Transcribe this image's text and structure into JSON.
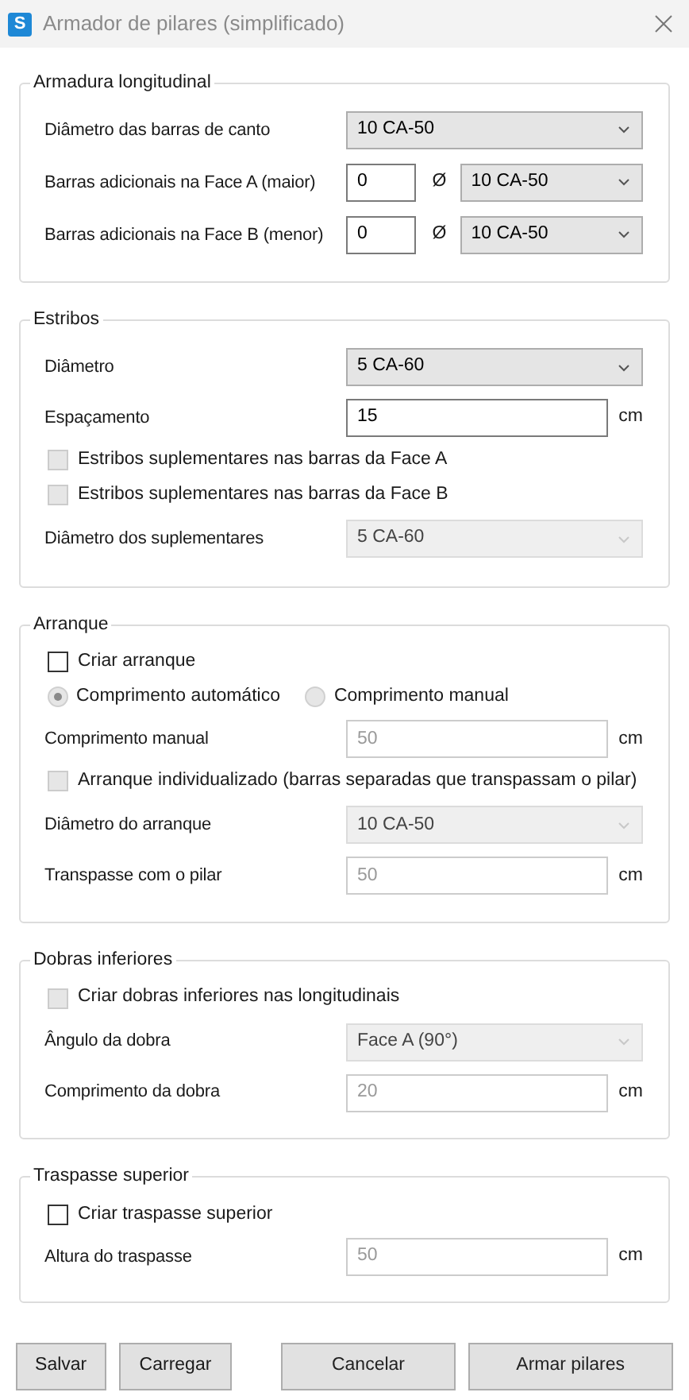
{
  "window": {
    "title": "Armador de pilares (simplificado)",
    "app_icon": "S"
  },
  "sections": [
    {
      "title": "Armadura longitudinal",
      "rows": [
        {
          "kind": "select",
          "label": "Diâmetro das barras de canto",
          "value": "10 CA-50",
          "disabled": false
        },
        {
          "kind": "pair",
          "label": "Barras adicionais na Face A (maior)",
          "count": "0",
          "symbol": "Ø",
          "value": "10 CA-50",
          "disabled": false
        },
        {
          "kind": "pair",
          "label": "Barras adicionais na Face B (menor)",
          "count": "0",
          "symbol": "Ø",
          "value": "10 CA-50",
          "disabled": false
        }
      ]
    },
    {
      "title": "Estribos",
      "rows": [
        {
          "kind": "select",
          "label": "Diâmetro",
          "value": "5 CA-60",
          "disabled": false
        },
        {
          "kind": "input",
          "label": "Espaçamento",
          "value": "15",
          "unit": "cm",
          "disabled": false
        },
        {
          "kind": "checkbox",
          "label": "Estribos suplementares nas barras da Face A",
          "checked": false,
          "disabled": true
        },
        {
          "kind": "checkbox",
          "label": "Estribos suplementares nas barras da Face B",
          "checked": false,
          "disabled": true
        },
        {
          "kind": "select",
          "label": "Diâmetro dos suplementares",
          "value": "5 CA-60",
          "disabled": true
        }
      ]
    },
    {
      "title": "Arranque",
      "rows": [
        {
          "kind": "checkbox",
          "label": "Criar arranque",
          "checked": false,
          "disabled": false
        },
        {
          "kind": "radios",
          "disabled": true,
          "options": [
            {
              "label": "Comprimento automático",
              "selected": true
            },
            {
              "label": "Comprimento manual",
              "selected": false
            }
          ]
        },
        {
          "kind": "input",
          "label": "Comprimento manual",
          "value": "50",
          "unit": "cm",
          "disabled": true
        },
        {
          "kind": "checkbox",
          "label": "Arranque individualizado (barras separadas que transpassam o pilar)",
          "checked": false,
          "disabled": true
        },
        {
          "kind": "select",
          "label": "Diâmetro do arranque",
          "value": "10 CA-50",
          "disabled": true
        },
        {
          "kind": "input",
          "label": "Transpasse com o pilar",
          "value": "50",
          "unit": "cm",
          "disabled": true
        }
      ]
    },
    {
      "title": "Dobras inferiores",
      "rows": [
        {
          "kind": "checkbox",
          "label": "Criar dobras inferiores nas longitudinais",
          "checked": false,
          "disabled": true
        },
        {
          "kind": "select",
          "label": "Ângulo da dobra",
          "value": "Face A (90°)",
          "disabled": true
        },
        {
          "kind": "input",
          "label": "Comprimento da dobra",
          "value": "20",
          "unit": "cm",
          "disabled": true
        }
      ]
    },
    {
      "title": "Traspasse superior",
      "rows": [
        {
          "kind": "checkbox",
          "label": "Criar traspasse superior",
          "checked": false,
          "disabled": false
        },
        {
          "kind": "input",
          "label": "Altura do traspasse",
          "value": "50",
          "unit": "cm",
          "disabled": true
        }
      ]
    }
  ],
  "buttons": [
    {
      "label": "Salvar",
      "kind": "left"
    },
    {
      "label": "Carregar",
      "kind": "left"
    },
    {
      "label": "Cancelar",
      "kind": "right"
    },
    {
      "label": "Armar pilares",
      "kind": "right"
    }
  ]
}
